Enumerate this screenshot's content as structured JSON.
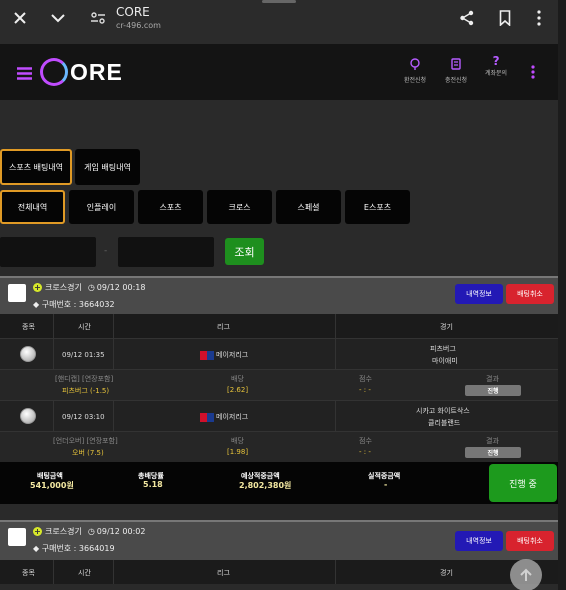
{
  "browser": {
    "title": "CORE",
    "url": "cr-496.com"
  },
  "header": {
    "logo_c": "C",
    "logo_text": "ORE",
    "menu": [
      "환전신청",
      "충전신청",
      "계좌문의"
    ]
  },
  "tabs": {
    "main": [
      "스포츠 배팅내역",
      "게임 배팅내역"
    ],
    "sub": [
      "전체내역",
      "인플레이",
      "스포츠",
      "크로스",
      "스페셜",
      "E스포츠"
    ]
  },
  "search": {
    "sep": "-",
    "button": "조회"
  },
  "cards": [
    {
      "type": "크로스경기",
      "date": "09/12 00:18",
      "id": "구매번호 : 3664032",
      "detail_btn": "내역정보",
      "cancel_btn": "배팅취소",
      "headers": [
        "종목",
        "시간",
        "리그",
        "경기"
      ],
      "games": [
        {
          "time": "09/12 01:35",
          "league": "메이저리그",
          "home": "피츠버그",
          "away": "마이애미",
          "market": "[핸디캡] [연장포함]",
          "pick": "피츠버그 (-1.5)",
          "odds_label": "배당",
          "odds": "[2.62]",
          "score_label": "점수",
          "score": "- : -",
          "result_label": "결과",
          "status": "진행"
        },
        {
          "time": "09/12 03:10",
          "league": "메이저리그",
          "home": "시카고 화이트삭스",
          "away": "클리블랜드",
          "market": "[언더오버] [연장포함]",
          "pick": "오버 (7.5)",
          "odds_label": "배당",
          "odds": "[1.98]",
          "score_label": "점수",
          "score": "- : -",
          "result_label": "결과",
          "status": "진행"
        }
      ],
      "summary": {
        "bet_label": "배팅금액",
        "bet": "541,000원",
        "odds_label": "총배당률",
        "odds": "5.18",
        "exp_label": "예상적중금액",
        "exp": "2,802,380원",
        "real_label": "실적중금액",
        "real": "-",
        "state": "진행 중"
      }
    },
    {
      "type": "크로스경기",
      "date": "09/12 00:02",
      "id": "구매번호 : 3664019",
      "detail_btn": "내역정보",
      "cancel_btn": "배팅취소",
      "headers": [
        "종목",
        "시간",
        "리그",
        "경기"
      ]
    }
  ],
  "colors": {
    "accent": "#c04cff",
    "selected_border": "#e09a25",
    "search_btn": "#1e8f1e",
    "detail": "#2319b5",
    "cancel": "#d8232e"
  }
}
